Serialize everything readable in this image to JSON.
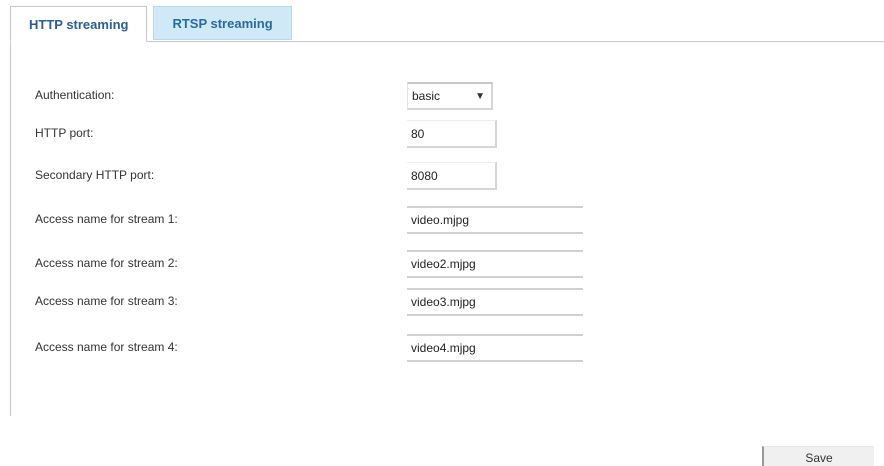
{
  "tabs": [
    {
      "label": "HTTP streaming",
      "active": true
    },
    {
      "label": "RTSP streaming",
      "active": false
    }
  ],
  "form": {
    "authentication": {
      "label": "Authentication:",
      "value": "basic"
    },
    "http_port": {
      "label": "HTTP port:",
      "value": "80"
    },
    "secondary_http_port": {
      "label": "Secondary HTTP port:",
      "value": "8080"
    },
    "stream1": {
      "label": "Access name for stream 1:",
      "value": "video.mjpg"
    },
    "stream2": {
      "label": "Access name for stream 2:",
      "value": "video2.mjpg"
    },
    "stream3": {
      "label": "Access name for stream 3:",
      "value": "video3.mjpg"
    },
    "stream4": {
      "label": "Access name for stream 4:",
      "value": "video4.mjpg"
    }
  },
  "actions": {
    "save_label": "Save"
  },
  "colors": {
    "active_tab_text": "#2a5f8f",
    "inactive_tab_bg": "#cfe9f7",
    "panel_border": "#c8c8c8"
  }
}
